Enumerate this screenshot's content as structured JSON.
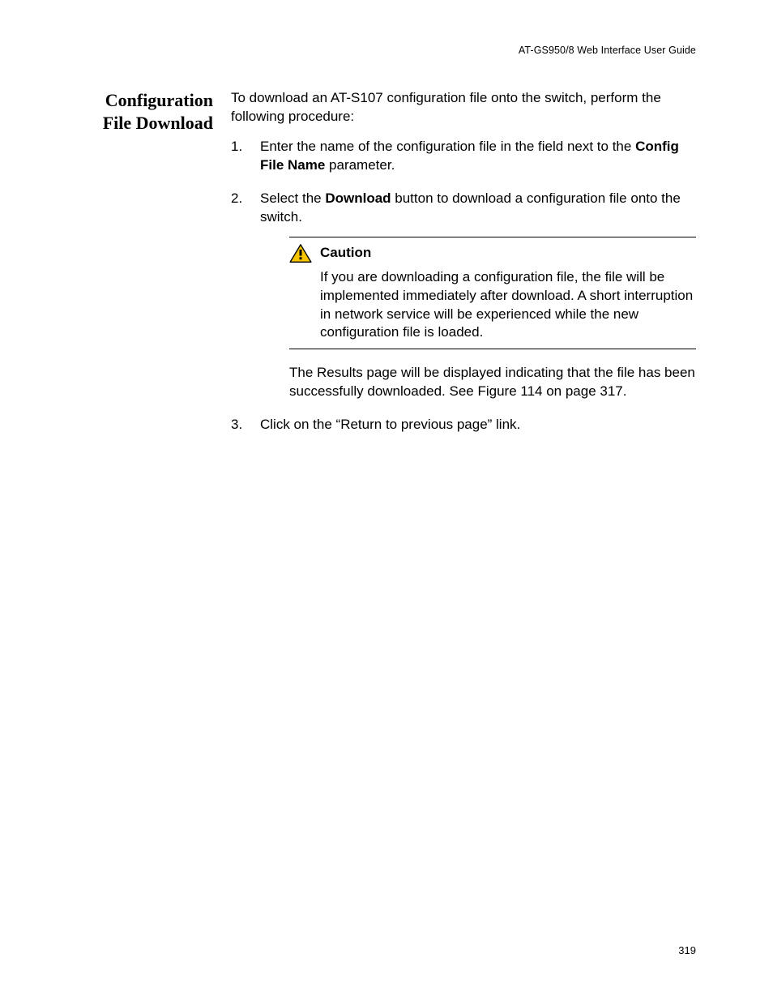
{
  "header": {
    "running_head": "AT-GS950/8  Web Interface User Guide"
  },
  "section": {
    "heading_line1": "Configuration",
    "heading_line2": "File Download",
    "intro": "To download an AT-S107 configuration file onto the switch, perform the following procedure:",
    "steps": {
      "s1a": "Enter the name of the configuration file in the field next to the ",
      "s1b": "Config File Name",
      "s1c": " parameter.",
      "s2a": "Select the ",
      "s2b": "Download",
      "s2c": " button to download a configuration file onto the switch.",
      "s3": "Click on the “Return to previous page” link."
    },
    "caution": {
      "title": "Caution",
      "body": "If you are downloading a configuration file, the file will be implemented immediately after download. A short interruption in network service will be experienced while the new configuration file is loaded."
    },
    "after_caution": "The Results page will be displayed indicating that the file has been successfully downloaded. See Figure 114 on page 317."
  },
  "footer": {
    "page_number": "319"
  }
}
